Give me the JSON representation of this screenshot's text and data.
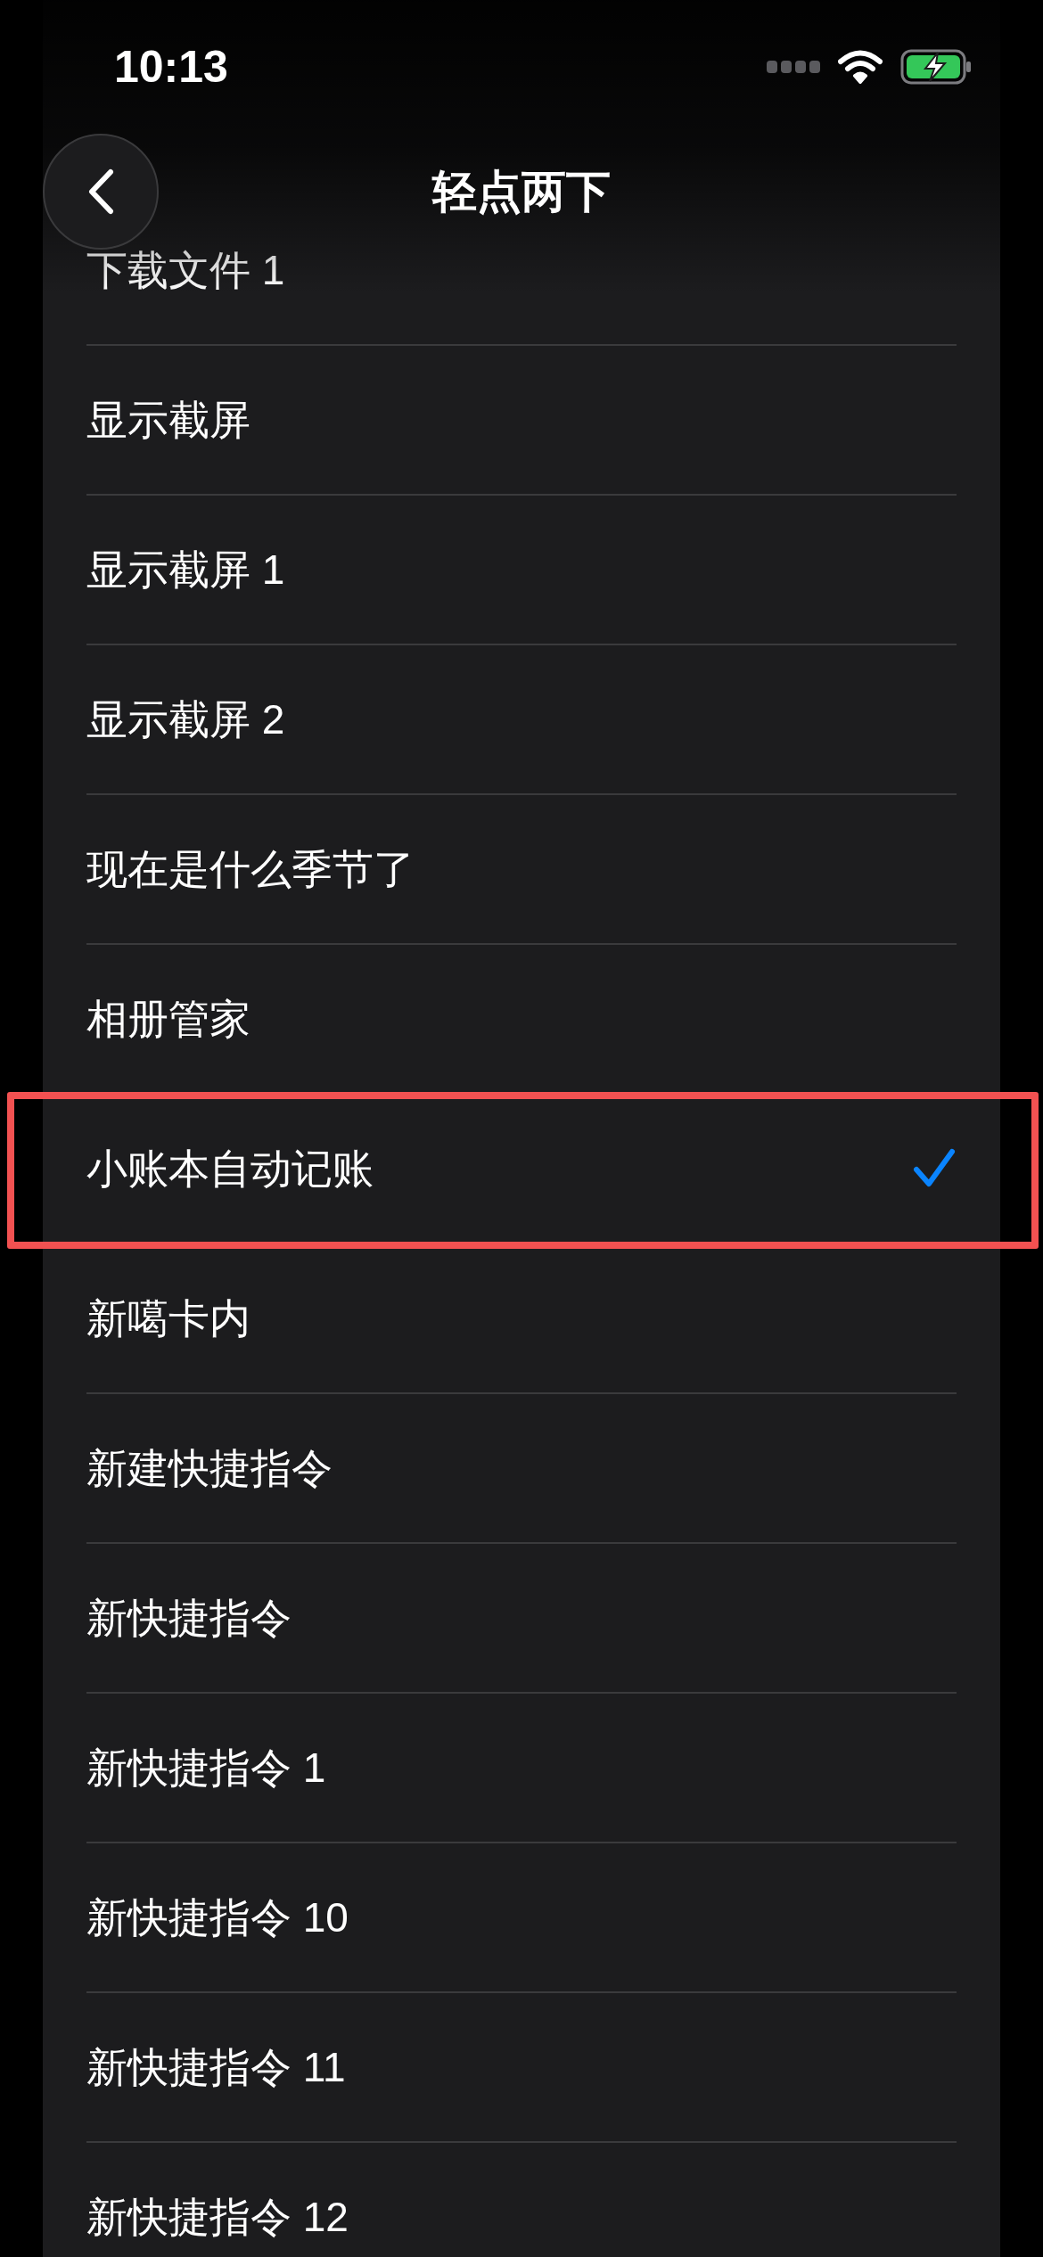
{
  "status_bar": {
    "time": "10:13"
  },
  "nav": {
    "title": "轻点两下"
  },
  "items": [
    {
      "label": "下载文件 1",
      "selected": false,
      "highlighted": false
    },
    {
      "label": "显示截屏",
      "selected": false,
      "highlighted": false
    },
    {
      "label": "显示截屏 1",
      "selected": false,
      "highlighted": false
    },
    {
      "label": "显示截屏 2",
      "selected": false,
      "highlighted": false
    },
    {
      "label": "现在是什么季节了",
      "selected": false,
      "highlighted": false
    },
    {
      "label": "相册管家",
      "selected": false,
      "highlighted": false
    },
    {
      "label": "小账本自动记账",
      "selected": true,
      "highlighted": true
    },
    {
      "label": "新噶卡内",
      "selected": false,
      "highlighted": false
    },
    {
      "label": "新建快捷指令",
      "selected": false,
      "highlighted": false
    },
    {
      "label": "新快捷指令",
      "selected": false,
      "highlighted": false
    },
    {
      "label": "新快捷指令 1",
      "selected": false,
      "highlighted": false
    },
    {
      "label": "新快捷指令 10",
      "selected": false,
      "highlighted": false
    },
    {
      "label": "新快捷指令 11",
      "selected": false,
      "highlighted": false
    },
    {
      "label": "新快捷指令 12",
      "selected": false,
      "highlighted": false
    }
  ]
}
